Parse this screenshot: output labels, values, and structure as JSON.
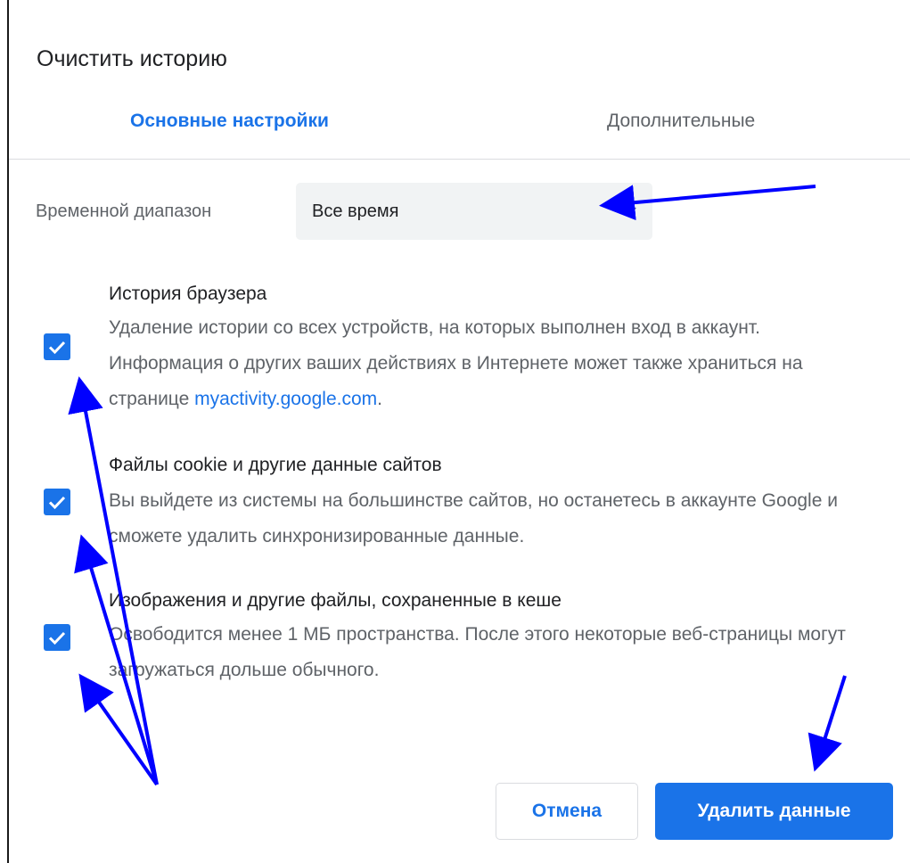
{
  "dialog": {
    "title": "Очистить историю",
    "tabs": [
      {
        "label": "Основные настройки",
        "active": true
      },
      {
        "label": "Дополнительные",
        "active": false
      }
    ],
    "time_range": {
      "label": "Временной диапазон",
      "value": "Все время"
    },
    "items": [
      {
        "title": "История браузера",
        "desc_before_link": "Удаление истории со всех устройств, на которых выполнен вход в аккаунт. Информация о других ваших действиях в Интернете может также храниться на странице ",
        "link": "myactivity.google.com",
        "desc_after_link": ".",
        "checked": true
      },
      {
        "title": "Файлы cookie и другие данные сайтов",
        "desc": "Вы выйдете из системы на большинстве сайтов, но останетесь в аккаунте Google и сможете удалить синхронизированные данные.",
        "checked": true
      },
      {
        "title": "Изображения и другие файлы, сохраненные в кеше",
        "desc": "Освободится менее 1 МБ пространства. После этого некоторые веб-страницы могут загружаться дольше обычного.",
        "checked": true
      }
    ],
    "buttons": {
      "cancel": "Отмена",
      "delete": "Удалить данные"
    }
  },
  "colors": {
    "accent": "#1a73e8",
    "annotation_arrow": "#0000ff"
  }
}
